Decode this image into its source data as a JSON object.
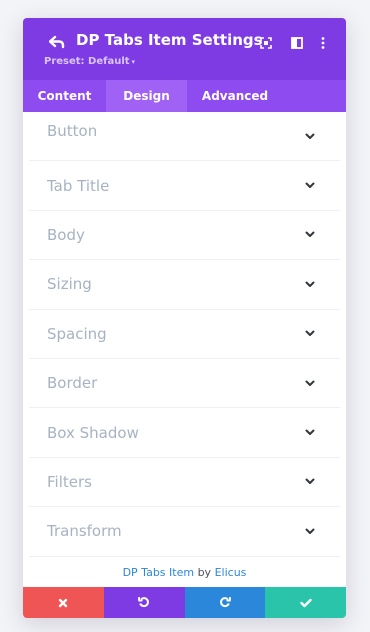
{
  "header": {
    "title": "DP Tabs Item Settings",
    "preset_label": "Preset: Default",
    "preset_caret": "▾"
  },
  "tabs": [
    {
      "label": "Content"
    },
    {
      "label": "Design"
    },
    {
      "label": "Advanced"
    }
  ],
  "active_tab": "Design",
  "groups": [
    {
      "label": "Button"
    },
    {
      "label": "Tab Title"
    },
    {
      "label": "Body"
    },
    {
      "label": "Sizing"
    },
    {
      "label": "Spacing"
    },
    {
      "label": "Border"
    },
    {
      "label": "Box Shadow"
    },
    {
      "label": "Filters"
    },
    {
      "label": "Transform"
    }
  ],
  "credit": {
    "module": "DP Tabs Item",
    "by": "by",
    "author": "Elicus"
  },
  "colors": {
    "header_bg": "#7e3be4",
    "tabs_bg": "#8e4bf0",
    "active_tab_bg": "#9f62f5",
    "discard": "#ef5555",
    "undo": "#7e3be4",
    "redo": "#2b87da",
    "save": "#29c4a9"
  },
  "icons": {
    "back": "back-arrow-icon",
    "expand": "expand-icon",
    "split": "split-view-icon",
    "more": "more-dots-icon",
    "discard": "close-icon",
    "undo": "undo-icon",
    "redo": "redo-icon",
    "save": "check-icon",
    "chevron": "chevron-down-icon"
  }
}
